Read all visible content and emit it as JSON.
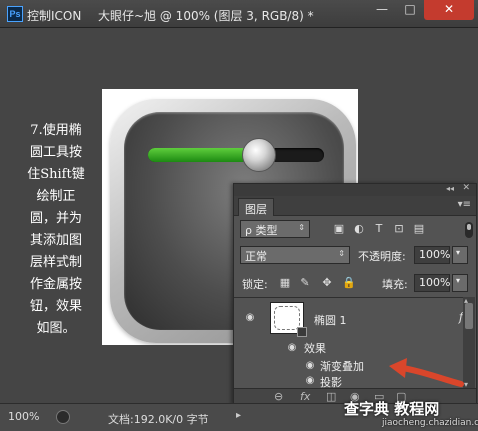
{
  "window": {
    "app_badge": "Ps",
    "tab_title": "控制ICON",
    "document_title": "大眼仔~旭 @ 100% (图层 3, RGB/8) *",
    "minimize": "—",
    "maximize": "□",
    "close": "✕"
  },
  "caption": {
    "text": "7.使用椭\n圆工具按\n住Shift键\n绘制正\n圆，并为\n其添加图\n层样式制\n作金属按\n钮，效果\n如图。"
  },
  "slider": {
    "fill_fraction": 0.63
  },
  "layers_panel": {
    "tab_label": "图层",
    "collapse_glyph": "◂◂",
    "close_glyph": "✕",
    "menu_glyph": "▾≡",
    "filter": {
      "prefix": "ρ",
      "label": "类型",
      "arrow": "⇕"
    },
    "filter_icons": [
      "▣",
      "◐",
      "T",
      "⊡",
      "▤"
    ],
    "blend_mode": {
      "label": "正常",
      "arrow": "⇕"
    },
    "opacity": {
      "label": "不透明度:",
      "value": "100%",
      "arrow": "▾"
    },
    "lock": {
      "label": "锁定:",
      "icons": [
        "▦",
        "✎",
        "✥",
        "🔒"
      ]
    },
    "fill": {
      "label": "填充:",
      "value": "100%",
      "arrow": "▾"
    },
    "layer": {
      "eye": "◉",
      "name": "椭圆 1",
      "fx": "fx",
      "fx_arrow": "▴"
    },
    "effects": {
      "eye": "◉",
      "label": "效果"
    },
    "effect_items": [
      {
        "eye": "◉",
        "label": "渐变叠加"
      },
      {
        "eye": "◉",
        "label": "投影"
      }
    ],
    "bottom_icons": [
      "⊖",
      "fx",
      "◫",
      "◉",
      "▭",
      "▢"
    ],
    "scroll_up": "▴",
    "scroll_down": "▾"
  },
  "status": {
    "zoom": "100%",
    "doc_info": "文档:192.0K/0 字节",
    "arrow": "▸"
  },
  "watermark": {
    "main": "查字典 教程网",
    "sub": "jiaocheng.chazidian.com"
  },
  "colors": {
    "accent_green": "#2fae1c",
    "arrow_red": "#d9462b",
    "close_red": "#c43b2e"
  }
}
